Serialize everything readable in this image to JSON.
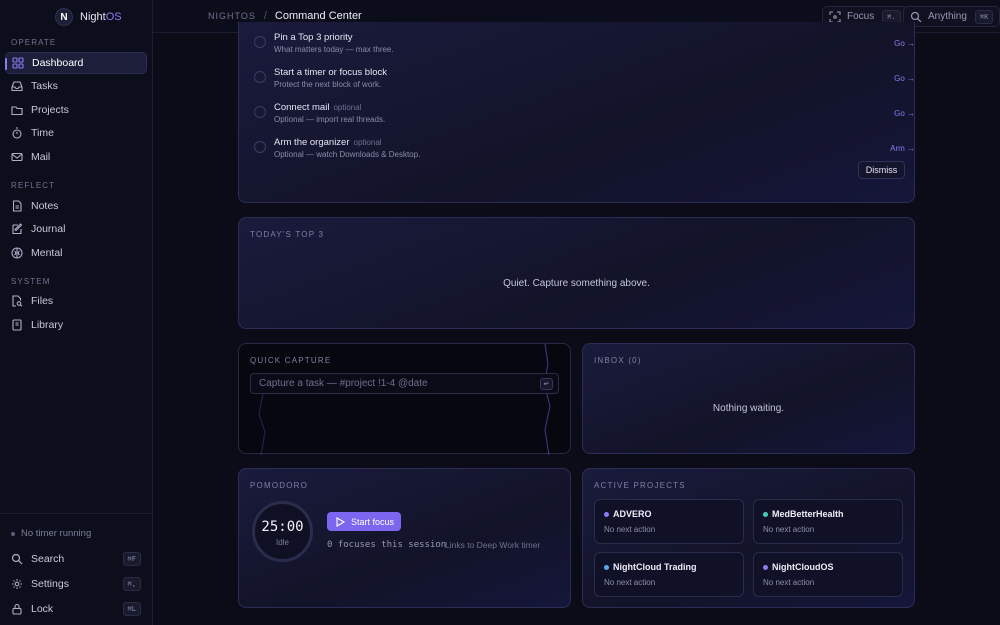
{
  "brand": {
    "logo_letter": "N",
    "name_main": "Night",
    "name_accent": "OS",
    "accent_color": "#8a7cf5"
  },
  "sidebar": {
    "sections": [
      {
        "label": "OPERATE"
      },
      {
        "label": "REFLECT"
      },
      {
        "label": "SYSTEM"
      }
    ],
    "items": [
      {
        "label": "Dashboard",
        "icon": "dashboard-icon",
        "active": true
      },
      {
        "label": "Tasks",
        "icon": "inbox-icon"
      },
      {
        "label": "Projects",
        "icon": "folder-icon"
      },
      {
        "label": "Time",
        "icon": "stopwatch-icon"
      },
      {
        "label": "Mail",
        "icon": "mail-icon"
      },
      {
        "label": "Notes",
        "icon": "document-icon"
      },
      {
        "label": "Journal",
        "icon": "edit-icon"
      },
      {
        "label": "Mental",
        "icon": "brain-icon"
      },
      {
        "label": "Files",
        "icon": "file-search-icon"
      },
      {
        "label": "Library",
        "icon": "book-icon"
      }
    ],
    "footer": {
      "timer_status": "No timer running",
      "search": {
        "label": "Search",
        "shortcut": "⌘F"
      },
      "settings": {
        "label": "Settings",
        "shortcut": "⌘,"
      },
      "lock": {
        "label": "Lock",
        "shortcut": "⌘L"
      }
    }
  },
  "topbar": {
    "breadcrumb_root": "NIGHTOS",
    "breadcrumb_sep": "/",
    "breadcrumb_current": "Command Center",
    "focus": {
      "label": "Focus",
      "shortcut": "⌘."
    },
    "anything": {
      "label": "Anything",
      "shortcut": "⌘K"
    }
  },
  "setup": {
    "tasks": [
      {
        "title": "Pin a Top 3 priority",
        "optional": "",
        "subtitle": "What matters today — max three.",
        "action": "Go →"
      },
      {
        "title": "Start a timer or focus block",
        "optional": "",
        "subtitle": "Protect the next block of work.",
        "action": "Go →"
      },
      {
        "title": "Connect mail",
        "optional": "optional",
        "subtitle": "Optional — import real threads.",
        "action": "Go →"
      },
      {
        "title": "Arm the organizer",
        "optional": "optional",
        "subtitle": "Optional — watch Downloads & Desktop.",
        "action": "Arm →"
      }
    ],
    "dismiss_label": "Dismiss"
  },
  "top3": {
    "label": "TODAY'S TOP 3",
    "empty": "Quiet. Capture something above."
  },
  "capture": {
    "label": "QUICK CAPTURE",
    "placeholder": "Capture a task — #project !1-4 @date",
    "enter_key": "↵"
  },
  "inbox": {
    "label": "INBOX (0)",
    "empty": "Nothing waiting."
  },
  "pomodoro": {
    "label": "POMODORO",
    "time": "25:00",
    "state": "Idle",
    "start_label": "Start focus",
    "session_info": "0 focuses this session",
    "link_text": "Links to Deep Work timer"
  },
  "projects": {
    "label": "ACTIVE PROJECTS",
    "items": [
      {
        "name": "ADVERO",
        "next": "No next action",
        "color": "#8a7cf5"
      },
      {
        "name": "MedBetterHealth",
        "next": "No next action",
        "color": "#3fd1b8"
      },
      {
        "name": "NightCloud Trading",
        "next": "No next action",
        "color": "#5aa9f0"
      },
      {
        "name": "NightCloudOS",
        "next": "No next action",
        "color": "#8a7cf5"
      }
    ]
  }
}
